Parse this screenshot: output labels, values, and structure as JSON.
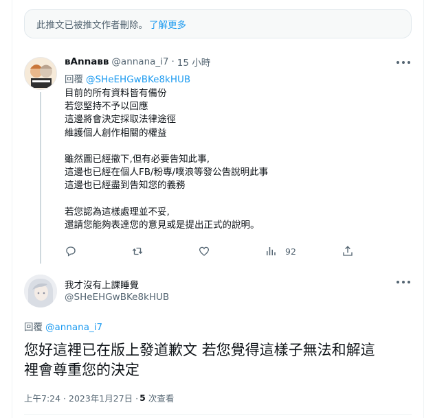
{
  "deleted_notice": {
    "text": "此推文已被推文作者刪除。",
    "link_label": "了解更多"
  },
  "reply_tweet": {
    "display_name": "ʙAnnaʙʙ",
    "handle": "@annana_i7",
    "separator": "·",
    "time": "15 小時",
    "reply_prefix": "回覆",
    "reply_to_handle": "@SHeEHGwBKe8kHUB",
    "paragraphs": [
      [
        "目前的所有資料皆有備份",
        "若您堅持不予以回應",
        "這邊將會決定採取法律途徑",
        "維護個人創作相關的權益"
      ],
      [
        "雖然圖已經撤下,但有必要告知此事,",
        "這邊也已經在個人FB/粉專/噗浪等發公告說明此事",
        "這邊也已經盡到告知您的義務"
      ],
      [
        "若您認為這樣處理並不妥,",
        "還請您能夠表達您的意見或是提出正式的說明。"
      ]
    ],
    "views_count": "92"
  },
  "main_tweet": {
    "display_name": "我才沒有上課睡覺",
    "handle": "@SHeEHGwBKe8kHUB",
    "reply_prefix": "回覆",
    "reply_to_handle": "@annana_i7",
    "text_lines": [
      "您好這裡已在版上發道歉文 若您覺得這樣子無法和解這",
      "裡會尊重您的決定"
    ],
    "timestamp": "上午7:24 · 2023年1月27日 ·",
    "views_count": "5",
    "views_label": "次查看"
  },
  "colors": {
    "accent": "#1d9bf0",
    "secondary_text": "#536471",
    "primary_text": "#0f1419"
  },
  "icons": [
    "reply-icon",
    "retweet-icon",
    "like-icon",
    "views-icon",
    "share-icon",
    "more-icon"
  ]
}
